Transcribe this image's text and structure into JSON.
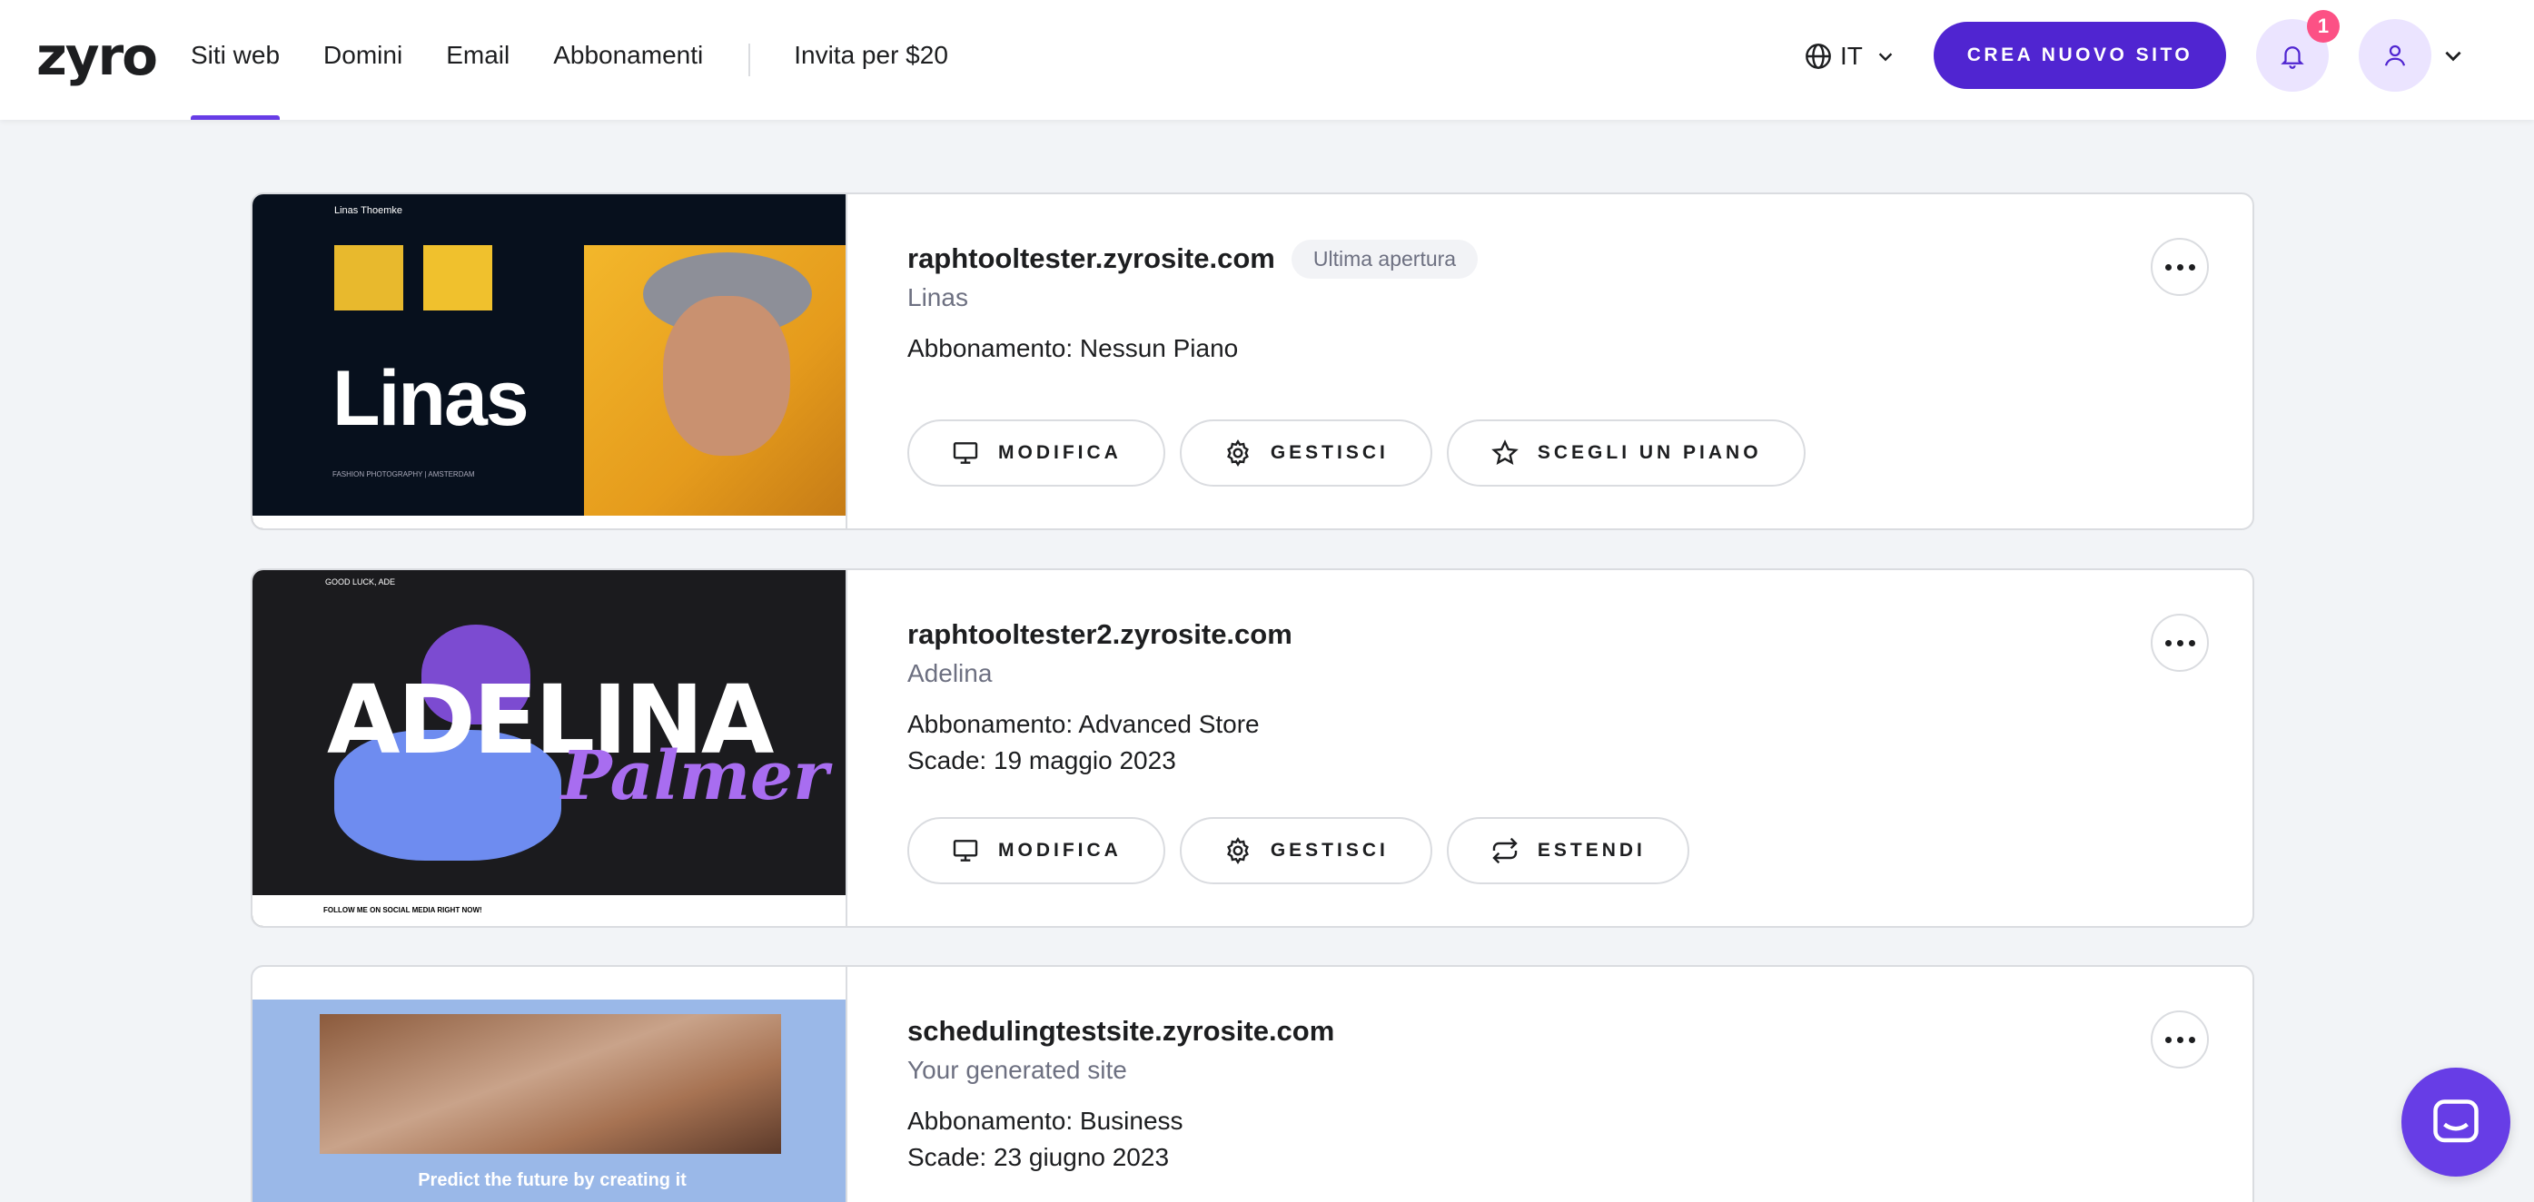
{
  "header": {
    "logo": "zyro",
    "nav": [
      {
        "label": "Siti web",
        "active": true
      },
      {
        "label": "Domini"
      },
      {
        "label": "Email"
      },
      {
        "label": "Abbonamenti"
      }
    ],
    "invite": "Invita per $20",
    "language": "IT",
    "create_button": "CREA NUOVO SITO",
    "notification_count": "1",
    "accent_color": "#5025d1"
  },
  "sites": [
    {
      "domain": "raphtooltester.zyrosite.com",
      "tag": "Ultima apertura",
      "name": "Linas",
      "plan": "Abbonamento: Nessun Piano",
      "buttons": [
        "MODIFICA",
        "GESTISCI",
        "SCEGLI UN PIANO"
      ],
      "thumbnail": {
        "header": "Linas Thoemke",
        "headline": "Linas",
        "caption": "FASHION PHOTOGRAPHY | AMSTERDAM"
      }
    },
    {
      "domain": "raphtooltester2.zyrosite.com",
      "name": "Adelina",
      "plan": "Abbonamento: Advanced Store",
      "expiry": "Scade: 19 maggio 2023",
      "buttons": [
        "MODIFICA",
        "GESTISCI",
        "ESTENDI"
      ],
      "thumbnail": {
        "logo": "GOOD LUCK, ADE",
        "headline": "ADELINA",
        "script": "Palmer",
        "footer": "FOLLOW ME ON SOCIAL MEDIA RIGHT NOW!"
      }
    },
    {
      "domain": "schedulingtestsite.zyrosite.com",
      "name": "Your generated site",
      "plan": "Abbonamento: Business",
      "expiry": "Scade: 23 giugno 2023",
      "thumbnail": {
        "headline": "Predict the future by creating it"
      }
    }
  ]
}
